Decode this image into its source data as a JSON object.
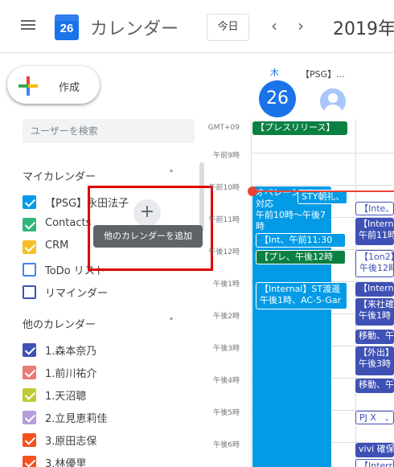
{
  "header": {
    "app_name": "カレンダー",
    "logo_day": "26",
    "today_button": "今日",
    "prev_icon": "‹",
    "next_icon": "›",
    "period_title": "2019年"
  },
  "create_button": {
    "label": "作成"
  },
  "sidebar": {
    "search_placeholder": "ユーザーを検索",
    "my_calendars": {
      "title": "マイカレンダー",
      "items": [
        {
          "label": "【PSG】永田法子",
          "color": "#039be5",
          "checked": true
        },
        {
          "label": "Contacts",
          "color": "#33b679",
          "checked": true
        },
        {
          "label": "CRM",
          "color": "#f6bf26",
          "checked": true
        },
        {
          "label": "ToDo リスト",
          "color": "#4285f4",
          "checked": false
        },
        {
          "label": "リマインダー",
          "color": "#3f51b5",
          "checked": false
        }
      ]
    },
    "other_calendars": {
      "title": "他のカレンダー",
      "add_tooltip": "他のカレンダーを追加",
      "items": [
        {
          "label": "1.森本奈乃",
          "color": "#3f51b5",
          "checked": true
        },
        {
          "label": "1.前川祐介",
          "color": "#e67c73",
          "checked": true
        },
        {
          "label": "1.天沼聰",
          "color": "#c0ca33",
          "checked": true
        },
        {
          "label": "2.立見恵莉佳",
          "color": "#b39ddb",
          "checked": true
        },
        {
          "label": "3.原田志保",
          "color": "#f4511e",
          "checked": true
        },
        {
          "label": "3.林優里",
          "color": "#f4511e",
          "checked": true
        }
      ]
    }
  },
  "day_header": {
    "weekday": "木",
    "day": "26",
    "second_column": "【PSG】..."
  },
  "time_grid": {
    "timezone": "GMT+09",
    "labels": [
      "午前9時",
      "午前10時",
      "午前11時",
      "午後12時",
      "午後1時",
      "午後2時",
      "午後3時",
      "午後4時",
      "午後5時",
      "午後6時"
    ]
  },
  "events": {
    "release": "【プレスリリース】",
    "main": [
      "オペレーション",
      "対応",
      "午前10時～午後7時"
    ],
    "sty": "STY朝礼、",
    "int": "【Int、午前11:30",
    "pre": "【プレ、午後12時",
    "internal": [
      "【Internal】ST渡邊",
      "午後1時、AC-5-Gar"
    ],
    "right": [
      "【Inte、",
      "【Internal",
      "午前11時",
      "【1on2】",
      "午後12時",
      "【Intern",
      "【来社確",
      "午後1時",
      "移動、午",
      "【外出】",
      "午後3時",
      "移動、午",
      "PJ X　、",
      "vivi 確保",
      "【Interr"
    ]
  }
}
